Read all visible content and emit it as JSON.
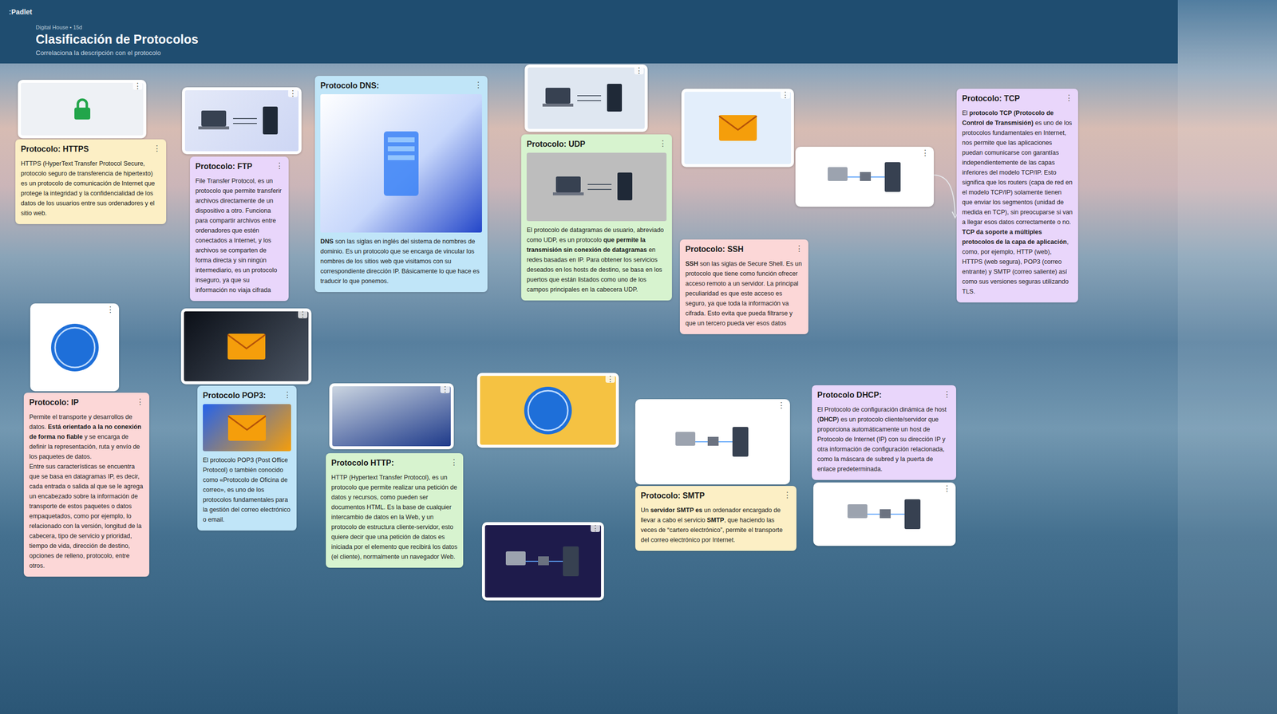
{
  "app": {
    "logo": ":Padlet"
  },
  "header": {
    "meta": "Digital House • 15d",
    "title": "Clasificación de Protocolos",
    "subtitle": "Correlaciona la descripción con el protocolo"
  },
  "posts": [
    {
      "kind": "image",
      "menu": "⋮"
    },
    {
      "kind": "note",
      "menu": "⋮",
      "title": "Protocolo: HTTPS",
      "color": "#fcefc5",
      "body": [
        [
          {
            "text": "HTTPS (HyperText Transfer Protocol Secure, protocolo seguro de transferencia de hipertexto) es un protocolo de comunicación de Internet que protege la integridad y la confidencialidad de los datos de los usuarios entre sus ordenadores y el sitio web.",
            "bold": false
          }
        ]
      ]
    },
    {
      "kind": "image",
      "menu": "⋮"
    },
    {
      "kind": "note",
      "menu": "⋮",
      "title": "Protocolo: FTP",
      "color": "#e9d6fb",
      "body": [
        [
          {
            "text": "File Transfer Protocol, es un protocolo que permite transferir archivos directamente de un dispositivo a otro. Funciona para compartir archivos entre ordenadores que estén conectados a Internet, y los archivos se comparten de forma directa y sin ningún intermediario, es un protocolo inseguro, ya que su información no viaja cifrada",
            "bold": false
          }
        ]
      ]
    },
    {
      "kind": "note_with_image",
      "menu": "⋮",
      "title": "Protocolo DNS:",
      "color": "#c0e5f8",
      "body": [
        [
          {
            "text": "DNS",
            "bold": true
          },
          {
            "text": " son las siglas en inglés del sistema de nombres de dominio. Es un protocolo que se encarga de vincular los nombres de los sitios web que visitamos con su correspondiente dirección IP. Básicamente lo que hace es traducir lo que ponemos.",
            "bold": false
          }
        ]
      ]
    },
    {
      "kind": "image",
      "menu": "⋮"
    },
    {
      "kind": "note_with_image",
      "menu": "⋮",
      "title": "Protocolo: UDP",
      "color": "#d7f3cf",
      "body": [
        [
          {
            "text": "El protocolo de datagramas de usuario, abreviado como UDP, es un protocolo ",
            "bold": false
          },
          {
            "text": "que permite la transmisión sin conexión de datagramas",
            "bold": true
          },
          {
            "text": " en redes basadas en IP. Para obtener los servicios deseados en los hosts de destino, se basa en los puertos que están listados como uno de los campos principales en la cabecera UDP.",
            "bold": false
          }
        ]
      ]
    },
    {
      "kind": "image",
      "menu": "⋮"
    },
    {
      "kind": "image",
      "menu": "⋮"
    },
    {
      "kind": "note",
      "menu": "⋮",
      "title": "Protocolo: TCP",
      "color": "#e9d6fb",
      "body": [
        [
          {
            "text": "El ",
            "bold": false
          },
          {
            "text": "protocolo TCP (Protocolo de Control de Transmisión)",
            "bold": true
          },
          {
            "text": " es uno de los protocolos fundamentales en Internet, nos permite que las aplicaciones puedan comunicarse con garantías independientemente de las capas inferiores del modelo TCP/IP. Esto significa que los routers (capa de red en el modelo TCP/IP) solamente tienen que enviar los segmentos (unidad de medida en TCP), sin preocuparse si van a llegar esos datos correctamente o no. ",
            "bold": false
          },
          {
            "text": "TCP da soporte a múltiples protocolos de la capa de aplicación",
            "bold": true
          },
          {
            "text": ", como, por ejemplo, HTTP (web), HTTPS (web segura), POP3 (correo entrante) y SMTP (correo saliente) así como sus versiones seguras utilizando TLS.",
            "bold": false
          }
        ]
      ]
    },
    {
      "kind": "note",
      "menu": "⋮",
      "title": "Protocolo: SSH",
      "color": "#fcd7d7",
      "body": [
        [
          {
            "text": "SSH",
            "bold": true
          },
          {
            "text": " son las siglas de Secure Shell. Es un protocolo que tiene como función ofrecer acceso remoto a un servidor. La principal peculiaridad es que este acceso es seguro, ya que toda la información va cifrada. Esto evita que pueda filtrarse y que un tercero pueda ver esos datos",
            "bold": false
          }
        ]
      ]
    },
    {
      "kind": "image",
      "menu": "⋮"
    },
    {
      "kind": "note",
      "menu": "⋮",
      "title": "Protocolo: IP",
      "color": "#fcd7d7",
      "body": [
        [
          {
            "text": "Permite el transporte y desarrollos de datos. ",
            "bold": false
          },
          {
            "text": "Está orientado a la no conexión de forma no fiable",
            "bold": true
          },
          {
            "text": " y se encarga de definir la representación, ruta y envío de los paquetes de datos.",
            "bold": false
          }
        ],
        [
          {
            "text": "Entre sus características se encuentra que se basa en datagramas IP, es decir, cada entrada o salida al que se le agrega un encabezado sobre la información de transporte de estos paquetes o datos empaquetados, como por ejemplo, lo relacionado con la versión, longitud de la cabecera, tipo de servicio y prioridad, tiempo de vida, dirección de destino, opciones de relleno, protocolo, entre otros.",
            "bold": false
          }
        ]
      ]
    },
    {
      "kind": "image",
      "menu": "⋮"
    },
    {
      "kind": "note_with_image",
      "menu": "⋮",
      "title": "Protocolo POP3:",
      "color": "#c0e5f8",
      "body": [
        [
          {
            "text": "El protocolo POP3 (Post Office Protocol) o también conocido como «Protocolo de Oficina de correo», es uno de los protocolos fundamentales para la gestión del correo electrónico o email.",
            "bold": false
          }
        ]
      ]
    },
    {
      "kind": "image",
      "menu": "⋮"
    },
    {
      "kind": "note",
      "menu": "⋮",
      "title": "Protocolo HTTP:",
      "color": "#d7f3cf",
      "body": [
        [
          {
            "text": "HTTP (Hypertext Transfer Protocol), es un protocolo que  permite realizar una petición de datos y recursos, como pueden ser documentos HTML. Es la base de cualquier intercambio de datos en la Web, y un protocolo de estructura cliente-servidor, esto quiere decir que una petición de datos es iniciada por el elemento que recibirá los datos (el cliente), normalmente un navegador Web.",
            "bold": false
          }
        ]
      ]
    },
    {
      "kind": "image",
      "menu": "⋮"
    },
    {
      "kind": "image",
      "menu": "⋮"
    },
    {
      "kind": "image",
      "menu": "⋮"
    },
    {
      "kind": "note",
      "menu": "⋮",
      "title": "Protocolo: SMTP",
      "color": "#fcefc5",
      "body": [
        [
          {
            "text": "Un ",
            "bold": false
          },
          {
            "text": "servidor SMTP es",
            "bold": true
          },
          {
            "text": " un ordenador encargado de llevar a cabo el servicio ",
            "bold": false
          },
          {
            "text": "SMTP",
            "bold": true
          },
          {
            "text": ", que haciendo las veces de “cartero electrónico”, permite el transporte del correo electrónico por Internet.",
            "bold": false
          }
        ]
      ]
    },
    {
      "kind": "note",
      "menu": "⋮",
      "title": "Protocolo DHCP:",
      "color": "#e9d6fb",
      "body": [
        [
          {
            "text": "El Protocolo de configuración dinámica de host (",
            "bold": false
          },
          {
            "text": "DHCP",
            "bold": true
          },
          {
            "text": ") es un protocolo cliente/servidor que proporciona automáticamente un host de Protocolo de Internet (IP) con su dirección IP y otra información de configuración relacionada, como la máscara de subred y la puerta de enlace predeterminada.",
            "bold": false
          }
        ]
      ]
    },
    {
      "kind": "image",
      "menu": "⋮"
    }
  ]
}
